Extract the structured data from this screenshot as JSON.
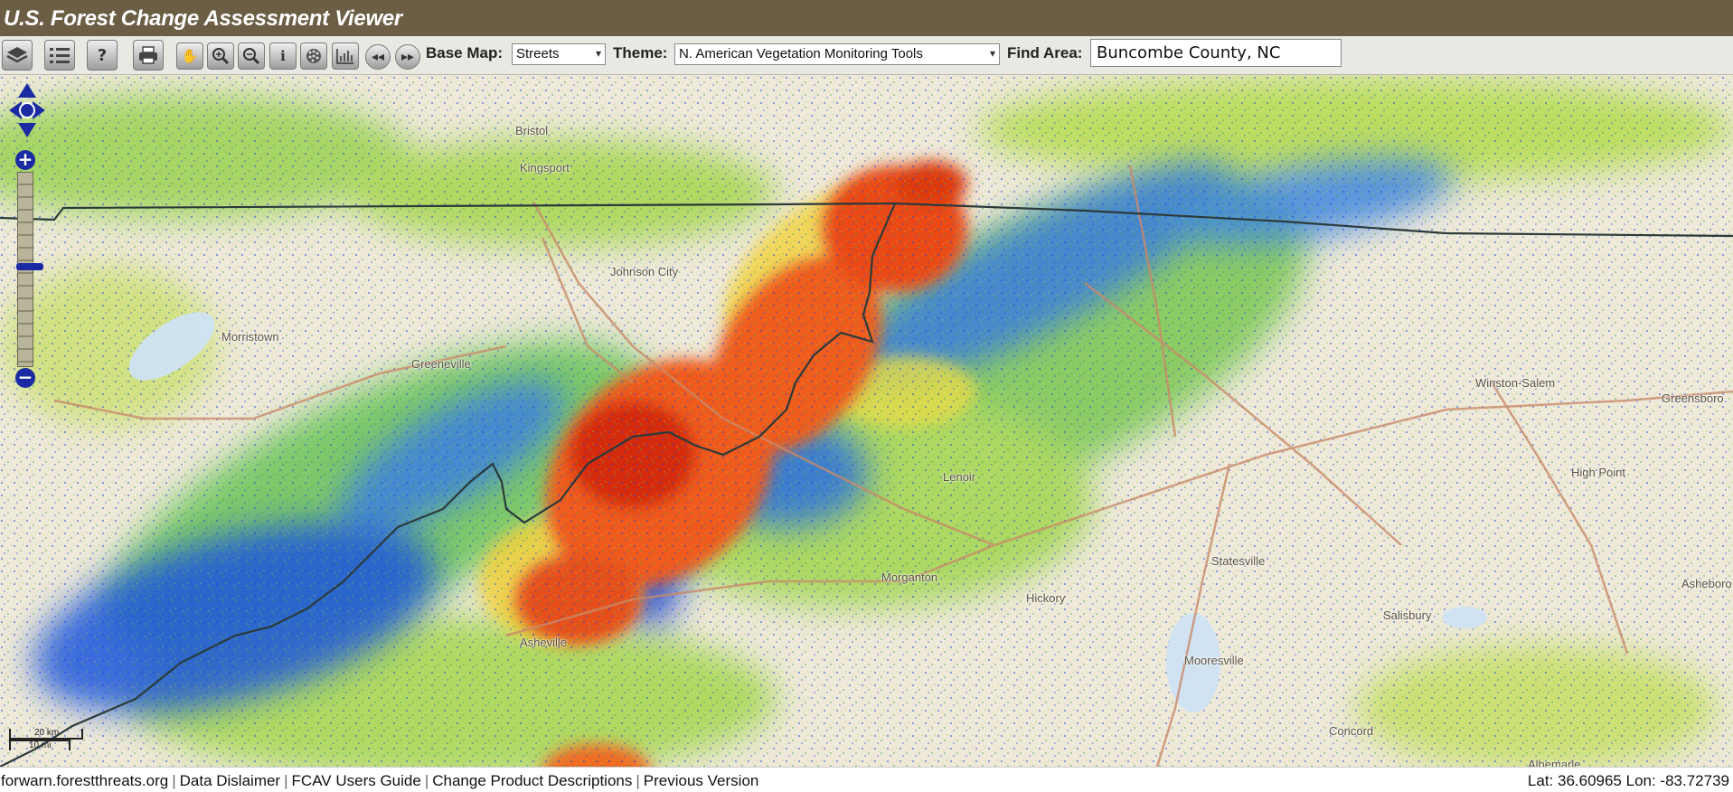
{
  "header": {
    "title": "U.S. Forest Change Assessment Viewer"
  },
  "toolbar": {
    "base_map_label": "Base Map:",
    "base_map_value": "Streets",
    "theme_label": "Theme:",
    "theme_value": "N. American Vegetation Monitoring Tools",
    "find_area_label": "Find Area:",
    "find_area_value": "Buncombe County, NC",
    "icons": [
      "layers-icon",
      "legend-list-icon",
      "help-icon",
      "print-icon",
      "pan-hand-icon",
      "zoom-in-icon",
      "zoom-out-icon",
      "identify-info-icon",
      "multigraph-icon",
      "phenograph-icon",
      "previous-extent-icon",
      "next-extent-icon"
    ]
  },
  "map": {
    "place_labels": [
      "Bristol",
      "Kingsport",
      "Johnson City",
      "Morristown",
      "Greeneville",
      "Winston-Salem",
      "Greensboro",
      "High Point",
      "Lenoir",
      "Morganton",
      "Hickory",
      "Statesville",
      "Asheville",
      "Mooresville",
      "Salisbury",
      "Concord",
      "Asheboro",
      "Albemarle"
    ],
    "scale": {
      "km": "20 km",
      "mi": "10 mi"
    }
  },
  "footer": {
    "links": [
      "forwarn.forestthreats.org",
      "Data Dislaimer",
      "FCAV Users Guide",
      "Change Product Descriptions",
      "Previous Version"
    ],
    "coords": "Lat: 36.60965 Lon: -83.72739"
  },
  "colors": {
    "header": "#6b5e45",
    "toolbar": "#e9e8e2",
    "decline": "#e63b12",
    "increase": "#1446d6",
    "neutral": "#c2e05a",
    "nav": "#1a2aa3"
  }
}
